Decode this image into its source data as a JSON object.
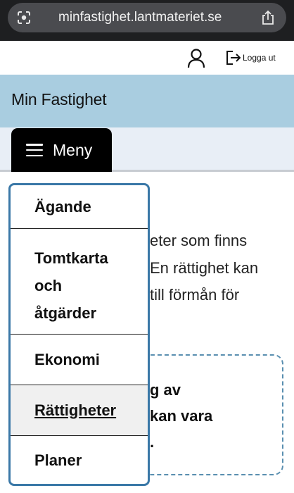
{
  "browser": {
    "url": "minfastighet.lantmateriet.se",
    "left_icon": "lens-icon",
    "right_icon": "share-icon"
  },
  "account": {
    "user_icon": "user-icon",
    "logout_label": "Logga ut"
  },
  "header": {
    "title": "Min Fastighet"
  },
  "nav": {
    "menu_label": "Meny",
    "items": [
      {
        "label": "Ägande",
        "active": false
      },
      {
        "label": "Tomtkarta\noch\nåtgärder",
        "active": false
      },
      {
        "label": "Ekonomi",
        "active": false
      },
      {
        "label": "Rättigheter",
        "active": true
      },
      {
        "label": "Planer",
        "active": false
      }
    ]
  },
  "content": {
    "lines": [
      "eter som finns",
      "En rättighet kan",
      " till förmån för"
    ],
    "info_lines": [
      "g av",
      "kan vara",
      "."
    ]
  },
  "colors": {
    "header_bg": "#a9cde0",
    "nav_bg": "#e8eef6",
    "dropdown_border": "#3a78a7",
    "info_border": "#5a8fb0"
  }
}
